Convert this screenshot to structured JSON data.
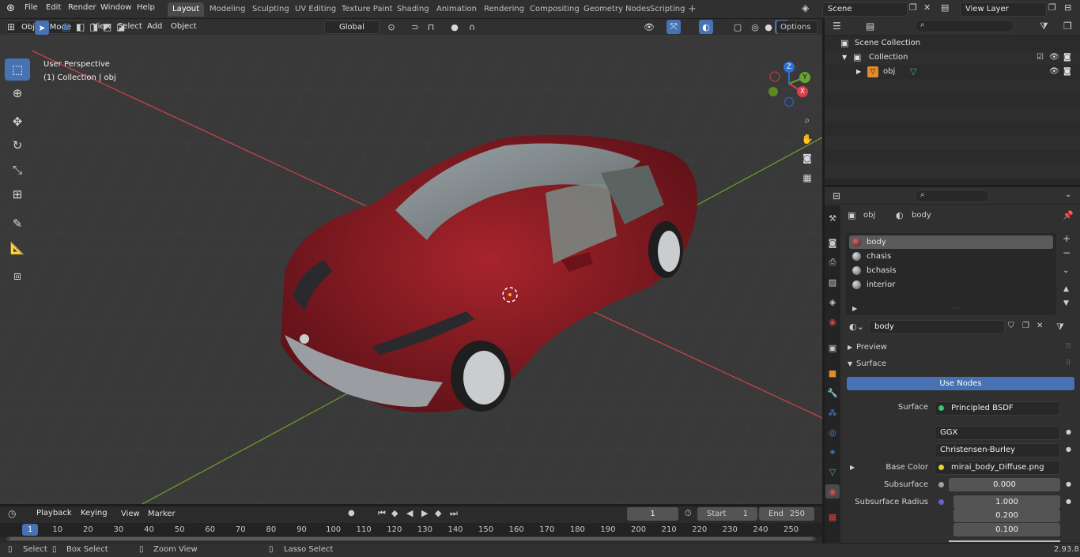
{
  "top_menu": [
    "File",
    "Edit",
    "Render",
    "Window",
    "Help"
  ],
  "workspaces": [
    {
      "label": "Layout",
      "active": true
    },
    {
      "label": "Modeling",
      "active": false
    },
    {
      "label": "Sculpting",
      "active": false
    },
    {
      "label": "UV Editing",
      "active": false
    },
    {
      "label": "Texture Paint",
      "active": false
    },
    {
      "label": "Shading",
      "active": false
    },
    {
      "label": "Animation",
      "active": false
    },
    {
      "label": "Rendering",
      "active": false
    },
    {
      "label": "Compositing",
      "active": false
    },
    {
      "label": "Geometry Nodes",
      "active": false
    },
    {
      "label": "Scripting",
      "active": false
    }
  ],
  "scene": {
    "name": "Scene",
    "view_layer": "View Layer"
  },
  "viewport_header": {
    "mode": "Object Mode",
    "menus": [
      "View",
      "Select",
      "Add",
      "Object"
    ],
    "transform_orientation": "Global",
    "options_label": "Options"
  },
  "viewport": {
    "perspective_label": "User Perspective",
    "collection_label": "(1) Collection | obj",
    "gizmo_axes": {
      "z": "Z",
      "y": "Y",
      "x": "X"
    }
  },
  "outliner": {
    "rows": [
      {
        "label": "Scene Collection"
      },
      {
        "label": "Collection"
      },
      {
        "label": "obj"
      }
    ]
  },
  "properties": {
    "breadcrumb_object": "obj",
    "breadcrumb_material": "body",
    "material_slots": [
      {
        "label": "body",
        "active": true
      },
      {
        "label": "chasis",
        "active": false
      },
      {
        "label": "bchasis",
        "active": false
      },
      {
        "label": "interior",
        "active": false
      }
    ],
    "material_name": "body",
    "panels": {
      "preview": "Preview",
      "surface": "Surface"
    },
    "use_nodes_label": "Use Nodes",
    "surface_label": "Surface",
    "surface_value": "Principled BSDF",
    "distribution": "GGX",
    "subsurface_method": "Christensen-Burley",
    "base_color_label": "Base Color",
    "base_color_value": "mirai_body_Diffuse.png",
    "subsurface_label": "Subsurface",
    "subsurface_value": "0.000",
    "subsurface_radius_label": "Subsurface Radius",
    "subsurface_radius_values": [
      "1.000",
      "0.200",
      "0.100"
    ]
  },
  "timeline": {
    "menus": [
      "Playback",
      "Keying",
      "View",
      "Marker"
    ],
    "current_frame": "1",
    "start_label": "Start",
    "start_value": "1",
    "end_label": "End",
    "end_value": "250",
    "frame_ticks": [
      "1",
      "10",
      "20",
      "30",
      "40",
      "50",
      "60",
      "70",
      "80",
      "90",
      "100",
      "110",
      "120",
      "130",
      "140",
      "150",
      "160",
      "170",
      "180",
      "190",
      "200",
      "210",
      "220",
      "230",
      "240",
      "250"
    ]
  },
  "status_bar": {
    "select": "Select",
    "box_select": "Box Select",
    "zoom_view": "Zoom View",
    "lasso_select": "Lasso Select",
    "version": "2.93.8"
  },
  "colors": {
    "accent": "#4772b3",
    "car_body": "#8a1c24",
    "x_axis": "#c8414b",
    "y_axis": "#6a9a2a"
  }
}
